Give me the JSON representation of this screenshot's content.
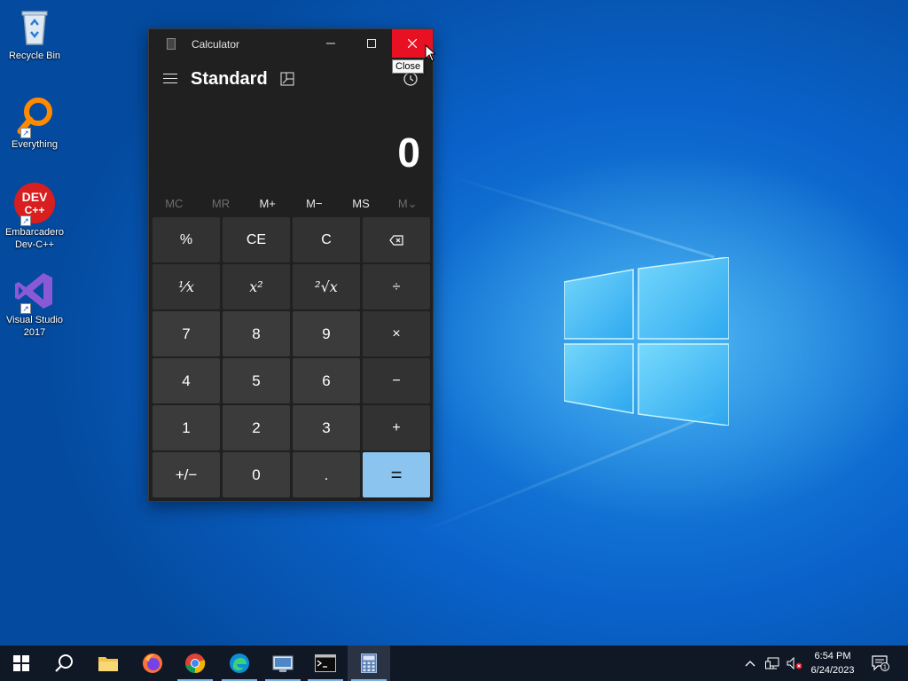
{
  "desktop": {
    "icons": [
      {
        "label": "Recycle Bin",
        "icon": "recycle-bin-icon"
      },
      {
        "label": "Everything",
        "icon": "everything-search-icon"
      },
      {
        "label": "Embarcadero Dev-C++",
        "icon": "devcpp-icon",
        "badge": "DEV C++"
      },
      {
        "label": "Visual Studio 2017",
        "icon": "visual-studio-icon"
      }
    ]
  },
  "calculator": {
    "window_title": "Calculator",
    "mode": "Standard",
    "display_value": "0",
    "close_tooltip": "Close",
    "memory": [
      {
        "label": "MC",
        "enabled": false
      },
      {
        "label": "MR",
        "enabled": false
      },
      {
        "label": "M+",
        "enabled": true
      },
      {
        "label": "M−",
        "enabled": true
      },
      {
        "label": "MS",
        "enabled": true
      },
      {
        "label": "M⌄",
        "enabled": false
      }
    ],
    "keys": {
      "percent": "%",
      "ce": "CE",
      "c": "C",
      "backspace": "⌫",
      "reciprocal": "¹⁄x",
      "square": "x²",
      "sqrt": "²√x",
      "divide": "÷",
      "n7": "7",
      "n8": "8",
      "n9": "9",
      "multiply": "×",
      "n4": "4",
      "n5": "5",
      "n6": "6",
      "minus": "−",
      "n1": "1",
      "n2": "2",
      "n3": "3",
      "plus": "+",
      "negate": "+/−",
      "n0": "0",
      "decimal": ".",
      "equals": "="
    },
    "colors": {
      "close_hover": "#e81123",
      "equals_bg": "#8cc4f0",
      "window_bg": "#202020"
    }
  },
  "taskbar": {
    "items": [
      "start-icon",
      "search-icon",
      "file-explorer-icon",
      "firefox-icon",
      "chrome-icon",
      "edge-icon",
      "control-panel-icon",
      "command-prompt-icon",
      "calculator-icon"
    ],
    "clock_time": "6:54 PM",
    "clock_date": "6/24/2023",
    "notification_count": "1"
  }
}
